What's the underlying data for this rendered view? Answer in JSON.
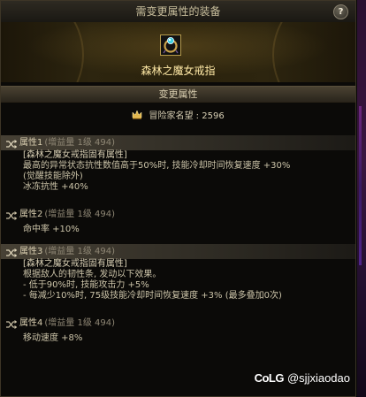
{
  "window": {
    "title": "需变更属性的装备",
    "help_label": "?"
  },
  "item": {
    "name": "森林之魔女戒指",
    "icon": "ring-icon"
  },
  "tab": {
    "label": "变更属性"
  },
  "fame": {
    "label": "冒险家名望 : 2596",
    "icon": "crown-icon"
  },
  "attributes": [
    {
      "title": "属性1",
      "sub": "(增益量 1级 494)",
      "highlighted": true,
      "lines": [
        "[森林之魔女戒指固有属性]",
        "最高的异常状态抗性数值高于50%时, 技能冷却时间恢复速度 +30%",
        "(觉醒技能除外)",
        "冰冻抗性 +40%"
      ]
    },
    {
      "title": "属性2",
      "sub": "(增益量 1级 494)",
      "highlighted": false,
      "lines": [
        "命中率 +10%"
      ]
    },
    {
      "title": "属性3",
      "sub": "(增益量 1级 494)",
      "highlighted": true,
      "lines": [
        "[森林之魔女戒指固有属性]",
        "根据敌人的韧性条, 发动以下效果。",
        "- 低于90%时, 技能攻击力 +5%",
        "- 每减少10%时, 75级技能冷却时间恢复速度 +3% (最多叠加0次)"
      ]
    },
    {
      "title": "属性4",
      "sub": "(增益量 1级 494)",
      "highlighted": false,
      "lines": [
        "移动速度 +8%"
      ]
    }
  ],
  "watermark": {
    "logo": "CoLG",
    "text": "@sjjxiaodao"
  },
  "colors": {
    "item_name": "#ffe9a6",
    "highlight_row": "#787060",
    "panel_bg": "#0b0a08"
  }
}
